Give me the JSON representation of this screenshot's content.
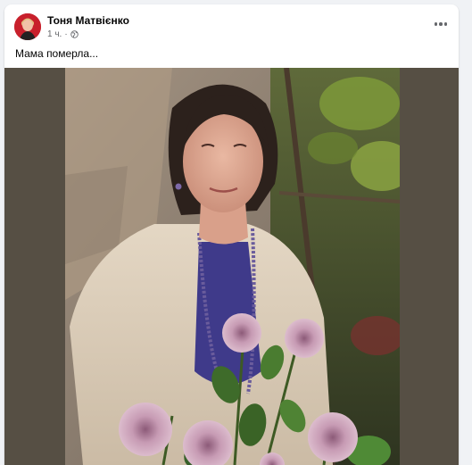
{
  "post": {
    "author": {
      "name": "Тоня Матвієнко"
    },
    "time": "1 ч.",
    "separator": "·",
    "privacy_icon": "globe-icon",
    "more_icon": "more-options-icon",
    "text": "Мама померла..."
  },
  "colors": {
    "photo_backdrop": "#564f44",
    "secondary_text": "#65676b",
    "primary_text": "#050505"
  }
}
